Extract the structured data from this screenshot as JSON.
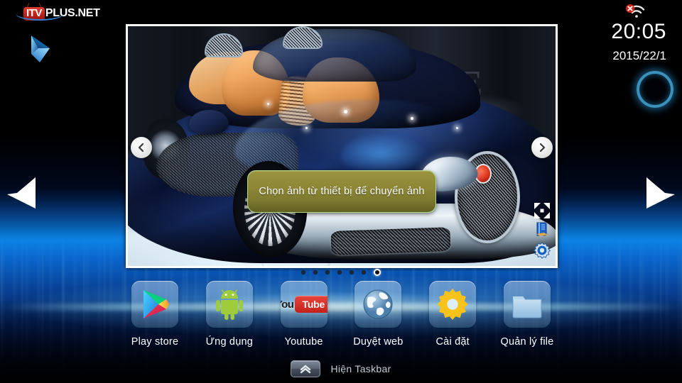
{
  "brand": {
    "mark": "ITV",
    "name": "PLUS.NET",
    "cursor_icon": "mouse-cursor-icon",
    "swoosh_icon": "swoosh-underline-icon"
  },
  "status": {
    "wifi_icon": "wifi-disconnected-icon",
    "time": "20:05",
    "date": "2015/22/1",
    "ring_button_icon": "power-ring-icon"
  },
  "navigation": {
    "left_arrow_icon": "arrow-left-icon",
    "right_arrow_icon": "arrow-right-icon",
    "prev_slide_icon": "chevron-left-icon",
    "next_slide_icon": "chevron-right-icon"
  },
  "viewer": {
    "photo_alt": "Dark blue Bugatti Veyron convertible with tan leather interior at an auto show",
    "overlay_message": "Chọn ảnh từ thiết bị để chuyển ảnh",
    "tools": [
      {
        "icon": "fullscreen-icon",
        "name": "fullscreen-tool"
      },
      {
        "icon": "book-icon",
        "name": "album-tool"
      },
      {
        "icon": "gear-icon",
        "name": "settings-tool"
      }
    ],
    "pagination": {
      "total": 7,
      "active_index": 6
    }
  },
  "dock": {
    "apps": [
      {
        "label": "Play store",
        "icon": "play-store-icon"
      },
      {
        "label": "Ứng dụng",
        "icon": "android-robot-icon"
      },
      {
        "label": "Youtube",
        "icon": "youtube-icon",
        "you": "You",
        "tube": "Tube"
      },
      {
        "label": "Duyệt web",
        "icon": "globe-icon"
      },
      {
        "label": "Cài đặt",
        "icon": "gear-icon"
      },
      {
        "label": "Quản lý file",
        "icon": "folder-icon"
      }
    ]
  },
  "taskbar": {
    "toggle_icon": "chevron-double-up-icon",
    "label": "Hiện Taskbar"
  },
  "colors": {
    "accent_blue": "#0a6fdc",
    "brand_red": "#c4241c",
    "overlay_olive": "#8e8836",
    "gear_yellow": "#f7c21a",
    "android_green": "#9fcc3a"
  }
}
